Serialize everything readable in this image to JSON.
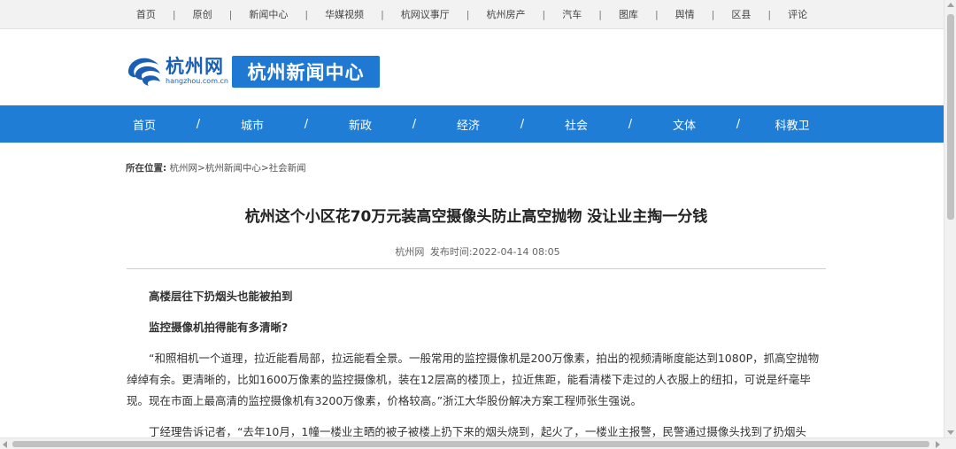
{
  "topbar": {
    "links": [
      "首页",
      "原创",
      "新闻中心",
      "华媒视频",
      "杭网议事厅",
      "杭州房产",
      "汽车",
      "图库",
      "舆情",
      "区县",
      "评论"
    ],
    "separator": "|"
  },
  "header": {
    "logo_cn": "杭州网",
    "logo_en": "hangzhou.com.cn",
    "section_title": "杭州新闻中心"
  },
  "nav": {
    "items": [
      "首页",
      "城市",
      "新政",
      "经济",
      "社会",
      "文体",
      "科教卫"
    ],
    "separator": "/"
  },
  "breadcrumb": {
    "label": "所在位置:",
    "path": "杭州网>杭州新闻中心>社会新闻"
  },
  "article": {
    "title": "杭州这个小区花70万元装高空摄像头防止高空抛物 没让业主掏一分钱",
    "source": "杭州网",
    "published_label": "发布时间:",
    "published": "2022-04-14 08:05",
    "sub1": "高楼层往下扔烟头也能被拍到",
    "sub2": "监控摄像机拍得能有多清晰?",
    "para1": "“和照相机一个道理，拉近能看局部，拉远能看全景。一般常用的监控摄像机是200万像素，拍出的视频清晰度能达到1080P，抓高空抛物绰绰有余。更清晰的，比如1600万像素的监控摄像机，装在12层高的楼顶上，拉近焦距，能看清楼下走过的人衣服上的纽扣，可说是纤毫毕现。现在市面上最高清的监控摄像机有3200万像素，价格较高。”浙江大华股份解决方案工程师张生强说。",
    "para2": "丁经理告诉记者，“去年10月，1幢一楼业主晒的被子被楼上扔下来的烟头烧到，起火了，一楼业主报警，民警通过摄像头找到了扔烟头"
  },
  "colors": {
    "nav_bg": "#1f7dd6",
    "badge_bg": "#1f78d1",
    "brand_blue": "#1a5fb4"
  }
}
